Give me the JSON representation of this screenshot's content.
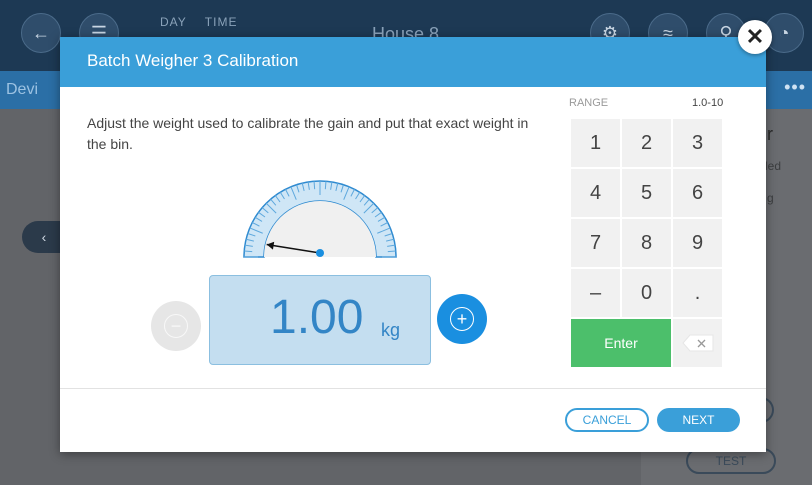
{
  "background": {
    "topbar": {
      "day_label": "DAY",
      "time_label": "TIME",
      "title": "House 8"
    },
    "subbar": {
      "label": "Devi"
    },
    "right_panel": {
      "heading": "r",
      "line1": "led",
      "line2": "g"
    },
    "test_button": "TEST"
  },
  "modal": {
    "title": "Batch Weigher 3 Calibration",
    "instruction": "Adjust the weight used to calibrate the gain and put that exact weight in the bin.",
    "value": "1.00",
    "unit": "kg",
    "gauge_level": 0.05,
    "range_label": "RANGE",
    "range_value": "1.0-10",
    "keypad": {
      "keys": [
        "1",
        "2",
        "3",
        "4",
        "5",
        "6",
        "7",
        "8",
        "9",
        "–",
        "0",
        "."
      ],
      "enter": "Enter"
    },
    "cancel_label": "CANCEL",
    "next_label": "NEXT"
  },
  "colors": {
    "header": "#3a9fd9",
    "value_text": "#3385c6",
    "value_box": "#c4def0",
    "enter": "#4cbf6b",
    "plus": "#1a8fe0"
  },
  "icons": [
    "back-icon",
    "menu-icon",
    "globe-icon",
    "wifi-icon",
    "search-icon",
    "close-icon",
    "minus-icon",
    "plus-icon",
    "backspace-icon",
    "chevron-left-icon"
  ]
}
